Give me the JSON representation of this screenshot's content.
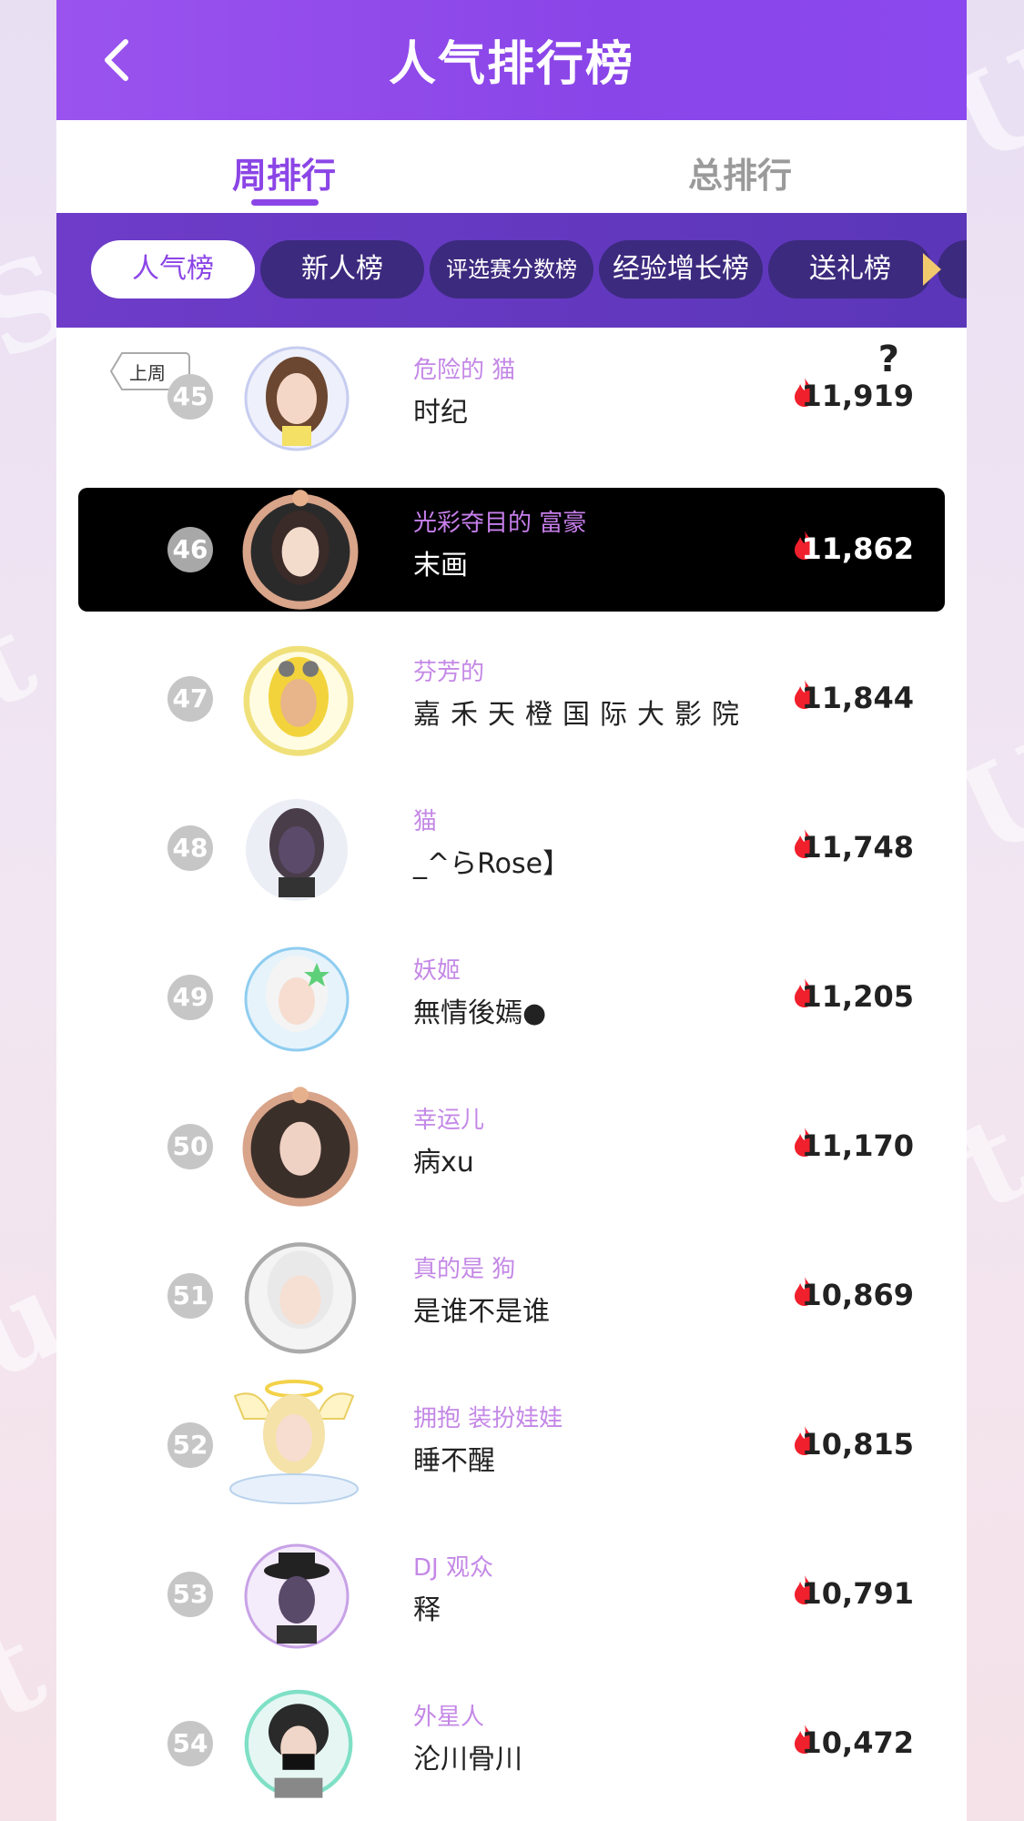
{
  "header": {
    "title": "人气排行榜"
  },
  "tabs": [
    {
      "label": "周排行"
    },
    {
      "label": "总排行"
    }
  ],
  "chips": [
    {
      "label": "人气榜"
    },
    {
      "label": "新人榜"
    },
    {
      "label": "评选赛分数榜"
    },
    {
      "label": "经验增长榜"
    },
    {
      "label": "送礼榜"
    }
  ],
  "badge": {
    "last_week": "上周",
    "help": "?"
  },
  "colors": {
    "accent": "#8b45e6",
    "header": "#9a53ee",
    "flame": "#f0202c"
  },
  "rows": [
    {
      "rank": "45",
      "title": "危险的 猫",
      "name": "时纪",
      "score": "11,919"
    },
    {
      "rank": "46",
      "title": "光彩夺目的 富豪",
      "name": "末画",
      "score": "11,862"
    },
    {
      "rank": "47",
      "title": "芬芳的",
      "name": "嘉禾天橙国际大影院",
      "score": "11,844"
    },
    {
      "rank": "48",
      "title": "猫",
      "name": "_^らRose】",
      "score": "11,748"
    },
    {
      "rank": "49",
      "title": "妖姬",
      "name": "無情後嫣●",
      "score": "11,205"
    },
    {
      "rank": "50",
      "title": "幸运儿",
      "name": "病xu",
      "score": "11,170"
    },
    {
      "rank": "51",
      "title": "真的是 狗",
      "name": "是谁不是谁",
      "score": "10,869"
    },
    {
      "rank": "52",
      "title": "拥抱 装扮娃娃",
      "name": "睡不醒",
      "score": "10,815"
    },
    {
      "rank": "53",
      "title": "DJ 观众",
      "name": "释",
      "score": "10,791"
    },
    {
      "rank": "54",
      "title": "外星人",
      "name": "沦川骨川",
      "score": "10,472"
    }
  ]
}
